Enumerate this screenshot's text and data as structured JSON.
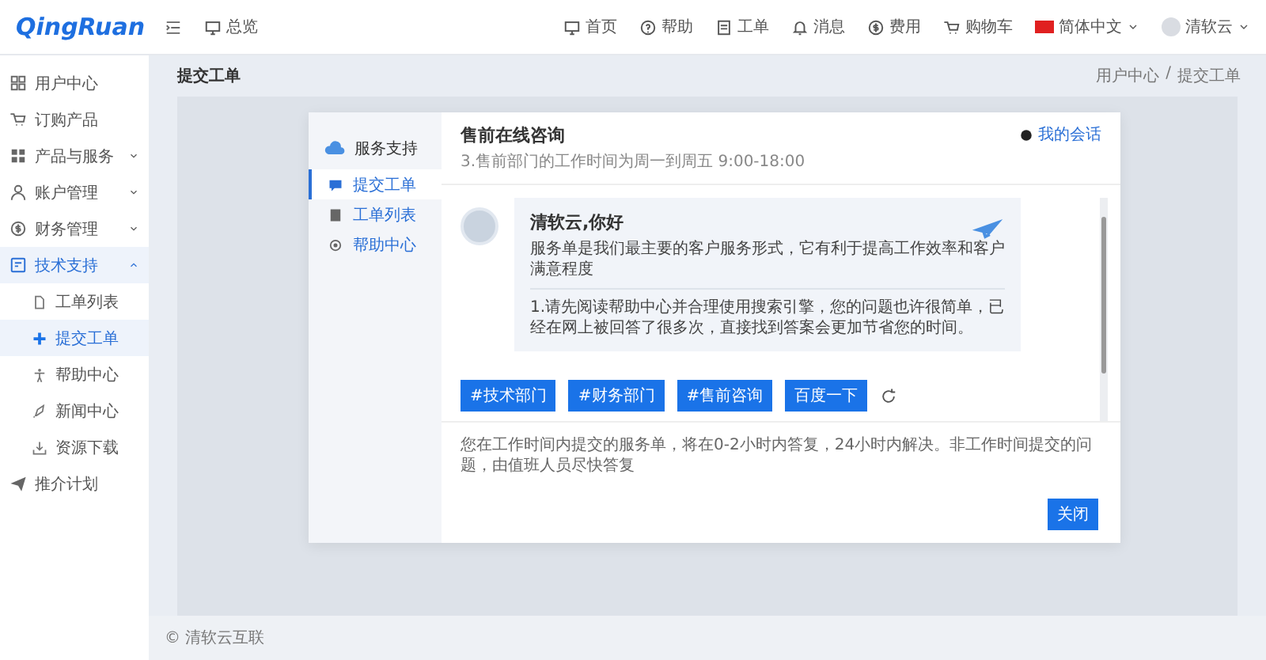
{
  "header": {
    "logo": "QingRuan",
    "overview": "总览",
    "nav": [
      "首页",
      "帮助",
      "工单",
      "消息",
      "费用",
      "购物车"
    ],
    "language": "简体中文",
    "user": "清软云"
  },
  "sidebar": {
    "items": [
      {
        "label": "用户中心",
        "selected": false
      },
      {
        "label": "订购产品",
        "selected": false
      },
      {
        "label": "产品与服务",
        "selected": false,
        "expanded": false
      },
      {
        "label": "账户管理",
        "selected": false,
        "expanded": false
      },
      {
        "label": "财务管理",
        "selected": false,
        "expanded": false
      },
      {
        "label": "技术支持",
        "selected": true,
        "expanded": true,
        "children": [
          {
            "label": "工单列表",
            "selected": false
          },
          {
            "label": "提交工单",
            "selected": true
          },
          {
            "label": "帮助中心",
            "selected": false
          },
          {
            "label": "新闻中心",
            "selected": false
          },
          {
            "label": "资源下载",
            "selected": false
          }
        ]
      },
      {
        "label": "推介计划",
        "selected": false
      }
    ]
  },
  "page": {
    "title": "提交工单",
    "breadcrumb": [
      "用户中心",
      "提交工单"
    ],
    "breadcrumb_separator": "/"
  },
  "dialog": {
    "side_title": "服务支持",
    "side_items": [
      {
        "label": "提交工单",
        "selected": true
      },
      {
        "label": "工单列表",
        "selected": false
      },
      {
        "label": "帮助中心",
        "selected": false
      }
    ],
    "title": "售前在线咨询",
    "subtitle": "3.售前部门的工作时间为周一到周五 9:00-18:00",
    "session_link": "我的会话",
    "greeting": "清软云,你好",
    "intro": "服务单是我们最主要的客户服务形式，它有利于提高工作效率和客户满意程度",
    "tip": "1.请先阅读帮助中心并合理使用搜索引擎，您的问题也许很简单，已经在网上被回答了很多次，直接找到答案会更加节省您的时间。",
    "quick_buttons": [
      "#技术部门",
      "#财务部门",
      "#售前咨询",
      "百度一下"
    ],
    "notice": "您在工作时间内提交的服务单，将在0-2小时内答复，24小时内解决。非工作时间提交的问题，由值班人员尽快答复",
    "close": "关闭"
  },
  "footer": "© 清软云互联"
}
